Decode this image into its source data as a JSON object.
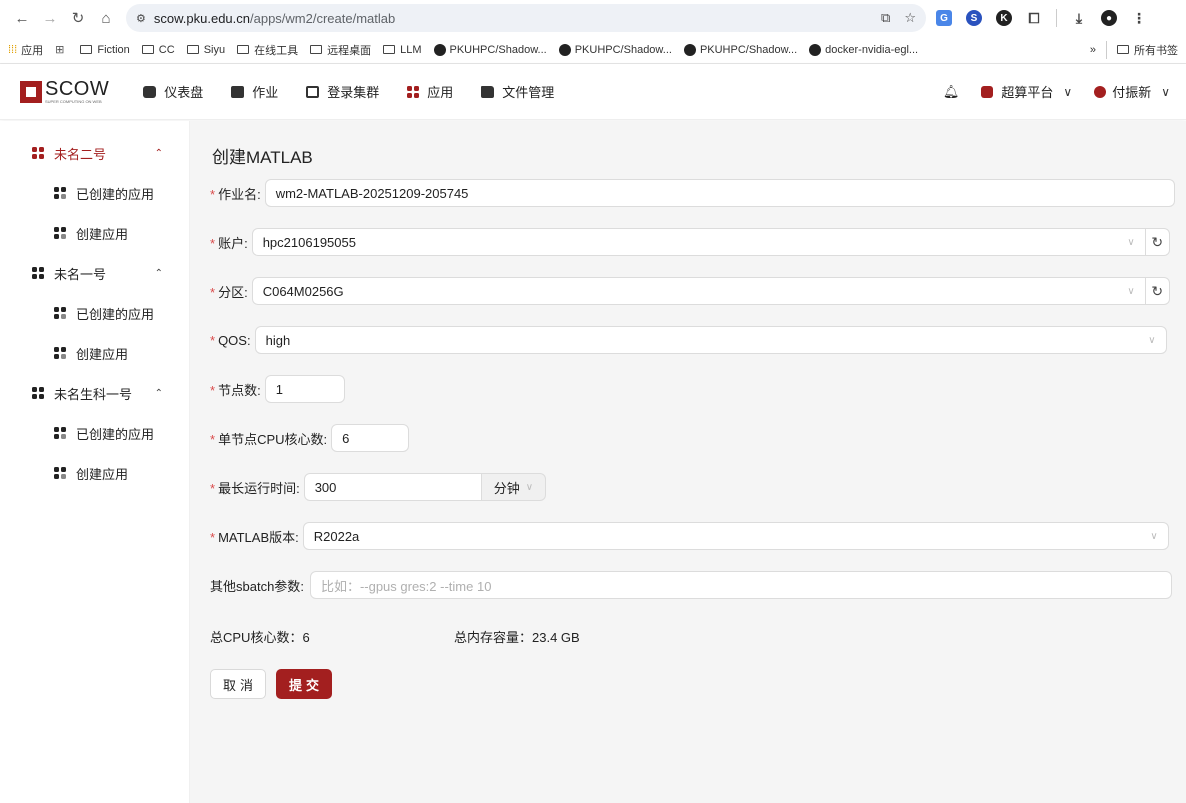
{
  "browser": {
    "url_domain": "scow.pku.edu.cn",
    "url_path": "/apps/wm2/create/matlab",
    "bookmarks": [
      "应用",
      "Fiction",
      "CC",
      "Siyu",
      "在线工具",
      "远程桌面",
      "LLM",
      "PKUHPC/Shadow...",
      "PKUHPC/Shadow...",
      "PKUHPC/Shadow...",
      "docker-nvidia-egl..."
    ],
    "bookmarks_overflow": "»",
    "all_bookmarks": "所有书签"
  },
  "header": {
    "logo_text": "SCOW",
    "logo_sub": "SUPER COMPUTING ON WEB",
    "menu": [
      "仪表盘",
      "作业",
      "登录集群",
      "应用",
      "文件管理"
    ],
    "platform": "超算平台",
    "user": "付振新"
  },
  "sidebar": {
    "groups": [
      {
        "label": "未名二号",
        "active": true,
        "items": [
          "已创建的应用",
          "创建应用"
        ]
      },
      {
        "label": "未名一号",
        "active": false,
        "items": [
          "已创建的应用",
          "创建应用"
        ]
      },
      {
        "label": "未名生科一号",
        "active": false,
        "items": [
          "已创建的应用",
          "创建应用"
        ]
      }
    ]
  },
  "form": {
    "title": "创建MATLAB",
    "job_name_label": "作业名",
    "job_name": "wm2-MATLAB-20251209-205745",
    "account_label": "账户",
    "account": "hpc2106195055",
    "partition_label": "分区",
    "partition": "C064M0256G",
    "qos_label": "QOS",
    "qos": "high",
    "nodes_label": "节点数",
    "nodes": "1",
    "cpu_label": "单节点CPU核心数",
    "cpu": "6",
    "time_label": "最长运行时间",
    "time": "300",
    "time_unit": "分钟",
    "version_label": "MATLAB版本",
    "version": "R2022a",
    "sbatch_label": "其他sbatch参数",
    "sbatch_placeholder": "比如：--gpus gres:2 --time 10",
    "total_cpu": "总CPU核心数：6",
    "total_mem": "总内存容量：23.4 GB",
    "cancel": "取消",
    "submit": "提交"
  },
  "colors": {
    "brand": "#a31f1f",
    "required": "#d94a4a"
  }
}
